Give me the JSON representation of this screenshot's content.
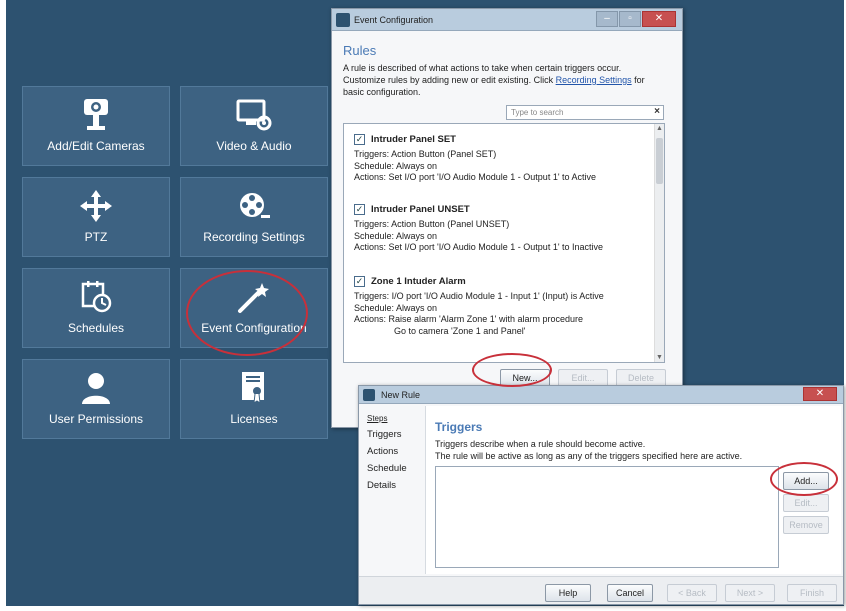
{
  "tiles": [
    {
      "label": "Add/Edit Cameras",
      "icon": "camera-icon"
    },
    {
      "label": "Video & Audio",
      "icon": "monitor-gear-icon"
    },
    {
      "label": "PTZ",
      "icon": "move-arrows-icon"
    },
    {
      "label": "Recording Settings",
      "icon": "film-reel-icon"
    },
    {
      "label": "Schedules",
      "icon": "calendar-clock-icon"
    },
    {
      "label": "Event Configuration",
      "icon": "magic-wand-icon"
    },
    {
      "label": "User Permissions",
      "icon": "user-icon"
    },
    {
      "label": "Licenses",
      "icon": "certificate-icon"
    }
  ],
  "event_window": {
    "title": "Event Configuration",
    "heading": "Rules",
    "desc_before": "A rule is described of what actions to take when certain triggers occur. Customize rules by adding new or edit existing. Click",
    "desc_link": "Recording Settings",
    "desc_after": "for basic configuration.",
    "search_placeholder": "Type to search",
    "rules": [
      {
        "name": "Intruder Panel SET",
        "triggers": "Triggers:  Action Button (Panel SET)",
        "schedule": "Schedule: Always on",
        "actions": [
          "Actions:   Set I/O port 'I/O Audio Module 1 - Output 1' to Active"
        ]
      },
      {
        "name": "Intruder Panel UNSET",
        "triggers": "Triggers:  Action Button (Panel UNSET)",
        "schedule": "Schedule: Always on",
        "actions": [
          "Actions:   Set I/O port 'I/O Audio Module 1 - Output 1' to Inactive"
        ]
      },
      {
        "name": "Zone 1 Intuder Alarm",
        "triggers": "Triggers:  I/O port 'I/O Audio Module 1 - Input 1' (Input) is Active",
        "schedule": "Schedule: Always on",
        "actions": [
          "Actions:   Raise alarm 'Alarm Zone 1' with alarm procedure",
          "Go to camera 'Zone 1 and Panel'"
        ]
      }
    ],
    "buttons": {
      "new": "New...",
      "edit": "Edit...",
      "delete": "Delete"
    }
  },
  "new_rule_window": {
    "title": "New Rule",
    "steps_label": "Steps",
    "steps": [
      "Triggers",
      "Actions",
      "Schedule",
      "Details"
    ],
    "heading": "Triggers",
    "desc1": "Triggers describe when a rule should become active.",
    "desc2": "The rule will be active as long as any of the triggers specified here are active.",
    "side_buttons": {
      "add": "Add...",
      "edit": "Edit...",
      "remove": "Remove"
    },
    "footer_buttons": {
      "help": "Help",
      "cancel": "Cancel",
      "back": "< Back",
      "next": "Next >",
      "finish": "Finish"
    }
  },
  "colors": {
    "desktop": "#2d5270",
    "tile": "#3d6282",
    "highlight": "#c8303a",
    "accent_title": "#4a7ab5"
  }
}
